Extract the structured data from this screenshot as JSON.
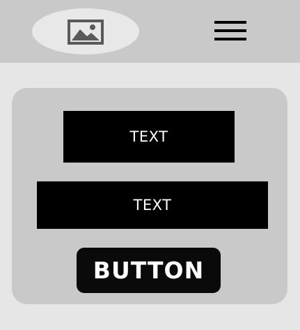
{
  "header": {
    "logo_icon": "image-placeholder-icon",
    "menu_icon": "hamburger-menu-icon"
  },
  "content": {
    "text_1": "TEXT",
    "text_2": "TEXT",
    "button_label": "BUTTON"
  },
  "colors": {
    "header_bg": "#c9c9c9",
    "page_bg": "#e6e6e6",
    "card_bg": "#c9c9c9",
    "block_bg": "#000000",
    "block_text": "#ffffff"
  }
}
